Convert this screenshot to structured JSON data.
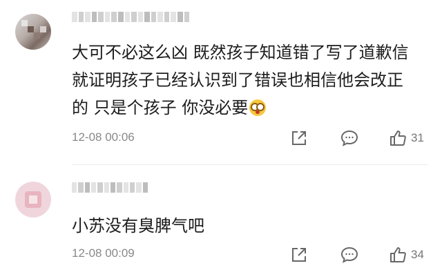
{
  "comments": [
    {
      "text": "大可不必这么凶 既然孩子知道错了写了道歉信就证明孩子已经认识到了错误也相信他会改正的 只是个孩子 你没必要",
      "emoji": "flushed-face-icon",
      "time": "12-08 00:06",
      "likes": "31"
    },
    {
      "text": "小苏没有臭脾气吧",
      "time": "12-08 00:09",
      "likes": "34"
    }
  ],
  "colors": {
    "text": "#1c1c1c",
    "meta": "#888888",
    "icon": "#666666"
  },
  "icons": {
    "share": "share-icon",
    "reply": "comment-bubble-icon",
    "like": "thumbs-up-icon"
  }
}
